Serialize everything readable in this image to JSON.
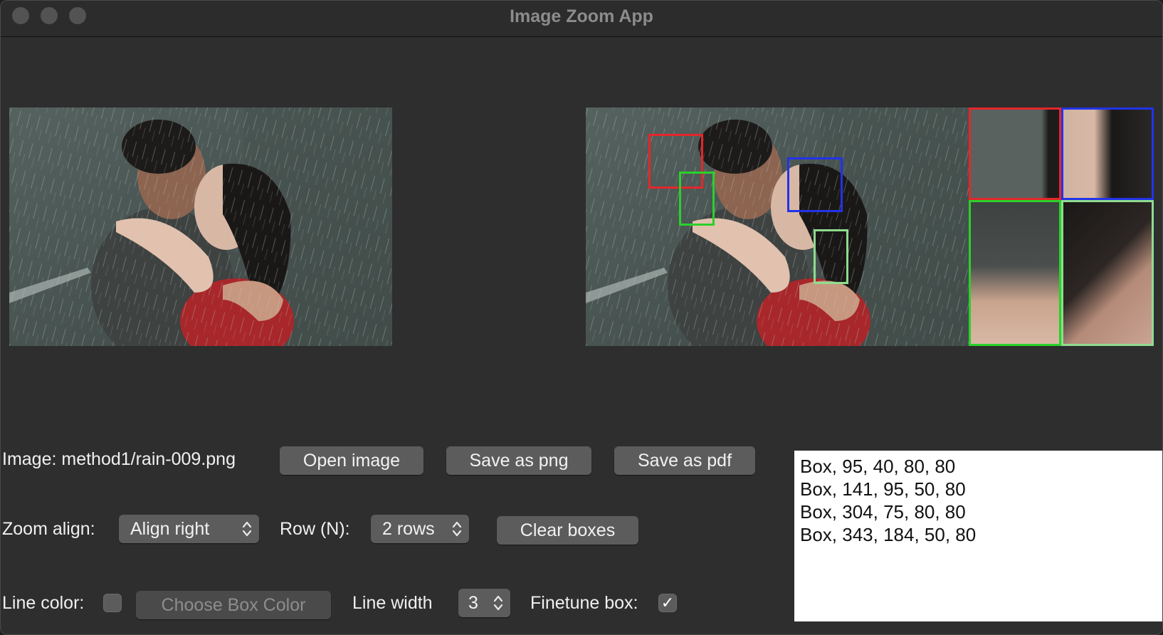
{
  "window": {
    "title": "Image Zoom App"
  },
  "image_info": {
    "label": "Image: method1/rain-009.png"
  },
  "buttons": {
    "open": "Open image",
    "save_png": "Save as png",
    "save_pdf": "Save as pdf",
    "clear": "Clear boxes",
    "choose_color": "Choose Box Color"
  },
  "controls": {
    "zoom_align_label": "Zoom align:",
    "zoom_align_value": "Align right",
    "rows_label": "Row (N):",
    "rows_value": "2 rows",
    "line_color_label": "Line color:",
    "line_color_checked": false,
    "line_width_label": "Line width",
    "line_width_value": "3",
    "finetune_label": "Finetune box:",
    "finetune_checked": true,
    "finetune_mark": "✓"
  },
  "boxes": [
    "Box, 95, 40, 80, 80",
    "Box, 141, 95, 50, 80",
    "Box, 304, 75, 80, 80",
    "Box, 343, 184, 50, 80"
  ],
  "box_colors": [
    "#e5262a",
    "#2ad12a",
    "#2233e8",
    "#8fdc8f"
  ],
  "images": {
    "original": "rain-couple-photo",
    "result": "rain-couple-photo-with-boxes",
    "zoom_crops": [
      "red-crop",
      "blue-crop",
      "green-crop",
      "light-green-crop"
    ]
  }
}
